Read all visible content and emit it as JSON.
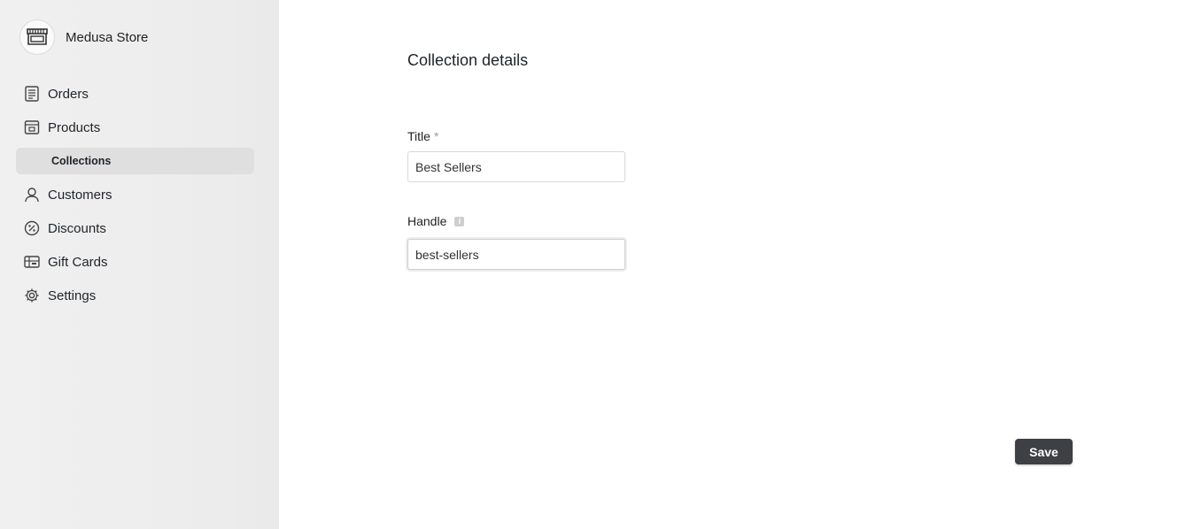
{
  "store": {
    "name": "Medusa Store",
    "icon": "storefront-icon"
  },
  "nav": {
    "items": [
      {
        "label": "Orders",
        "icon": "orders-icon"
      },
      {
        "label": "Products",
        "icon": "products-icon"
      },
      {
        "label": "Collections",
        "icon": ""
      },
      {
        "label": "Customers",
        "icon": "customers-icon"
      },
      {
        "label": "Discounts",
        "icon": "discounts-icon"
      },
      {
        "label": "Gift Cards",
        "icon": "gift-cards-icon"
      },
      {
        "label": "Settings",
        "icon": "settings-icon"
      }
    ],
    "active": "Collections"
  },
  "form": {
    "heading": "Collection details",
    "title_label": "Title",
    "title_required": "*",
    "title_value": "Best Sellers",
    "handle_label": "Handle",
    "handle_value": "best-sellers"
  },
  "actions": {
    "save_label": "Save"
  },
  "colors": {
    "sidebar_bg": "#ececec",
    "active_nav_bg": "#dfdfdf",
    "save_bg": "#3e4044"
  }
}
